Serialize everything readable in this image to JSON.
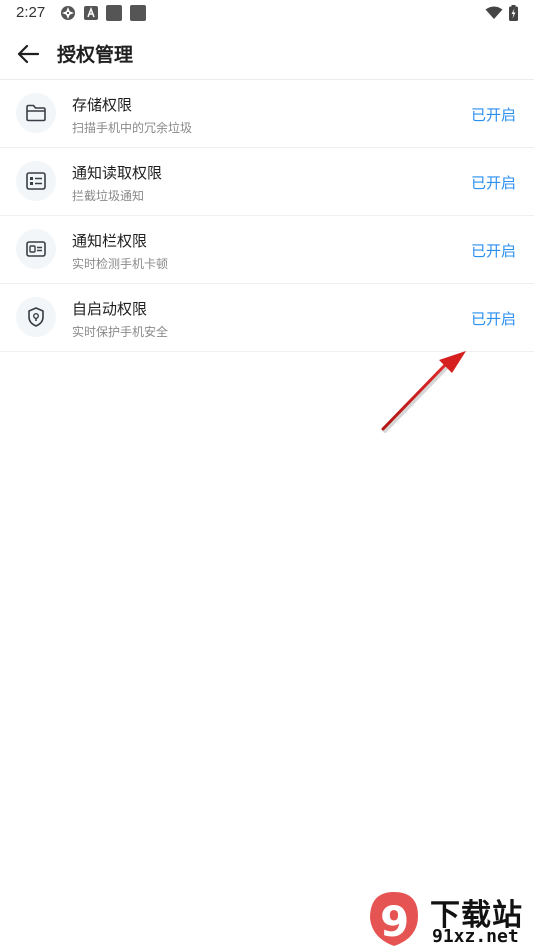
{
  "status_bar": {
    "time": "2:27"
  },
  "header": {
    "title": "授权管理"
  },
  "permissions": [
    {
      "title": "存储权限",
      "subtitle": "扫描手机中的冗余垃圾",
      "status": "已开启",
      "icon": "folder-icon"
    },
    {
      "title": "通知读取权限",
      "subtitle": "拦截垃圾通知",
      "status": "已开启",
      "icon": "list-card-icon"
    },
    {
      "title": "通知栏权限",
      "subtitle": "实时检测手机卡顿",
      "status": "已开启",
      "icon": "id-card-icon"
    },
    {
      "title": "自启动权限",
      "subtitle": "实时保护手机安全",
      "status": "已开启",
      "icon": "shield-icon"
    }
  ],
  "watermark": {
    "brand": "下载站",
    "domain": "91xz.net",
    "logo_mark": "9"
  },
  "colors": {
    "accent": "#2b8ff0",
    "annotation_arrow": "#d61f1f",
    "icon_bg": "#f2f6f9"
  }
}
